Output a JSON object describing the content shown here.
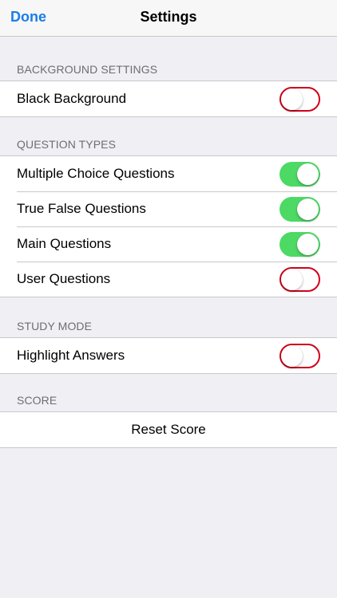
{
  "navbar": {
    "done_label": "Done",
    "title": "Settings"
  },
  "sections": {
    "background": {
      "header": "BACKGROUND SETTINGS",
      "items": [
        {
          "label": "Black Background",
          "on": false
        }
      ]
    },
    "question_types": {
      "header": "QUESTION TYPES",
      "items": [
        {
          "label": "Multiple Choice Questions",
          "on": true
        },
        {
          "label": "True False Questions",
          "on": true
        },
        {
          "label": "Main Questions",
          "on": true
        },
        {
          "label": "User Questions",
          "on": false
        }
      ]
    },
    "study_mode": {
      "header": "STUDY MODE",
      "items": [
        {
          "label": "Highlight Answers",
          "on": false
        }
      ]
    },
    "score": {
      "header": "SCORE",
      "reset_label": "Reset Score"
    }
  },
  "colors": {
    "accent": "#1a7ee6",
    "toggle_on": "#4cd964",
    "toggle_off_border": "#d0021b",
    "background": "#efeff4"
  }
}
